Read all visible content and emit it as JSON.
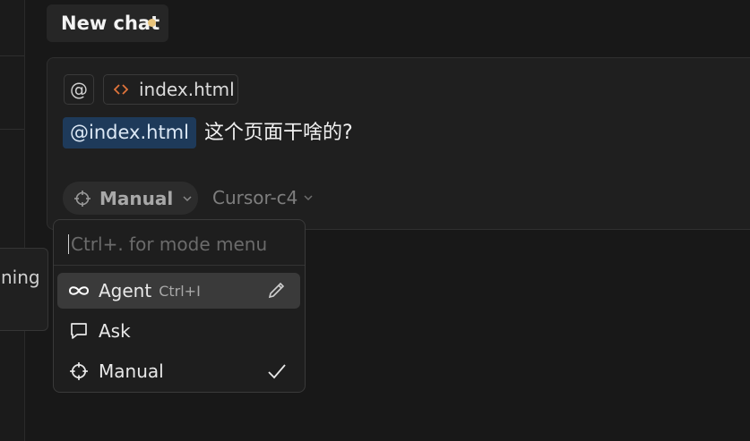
{
  "tab": {
    "title": "New chat"
  },
  "composer": {
    "context_file": "index.html",
    "mention": "@index.html",
    "question": "这个页面干啥的?",
    "mode": "Manual",
    "model": "Cursor-c4"
  },
  "tooltip": {
    "text": "ning"
  },
  "mode_menu": {
    "placeholder": "Ctrl+. for mode menu",
    "items": [
      {
        "label": "Agent",
        "shortcut": "Ctrl+I",
        "icon": "infinity-icon",
        "action_icon": "pencil-icon"
      },
      {
        "label": "Ask",
        "icon": "chat-bubble-icon"
      },
      {
        "label": "Manual",
        "icon": "crosshair-icon",
        "selected_icon": "checkmark-icon"
      }
    ]
  },
  "colors": {
    "background": "#181818",
    "mention_bg": "#1e3a5a",
    "unsaved_dot": "#e8c37a",
    "code_icon": "#e0743b"
  }
}
